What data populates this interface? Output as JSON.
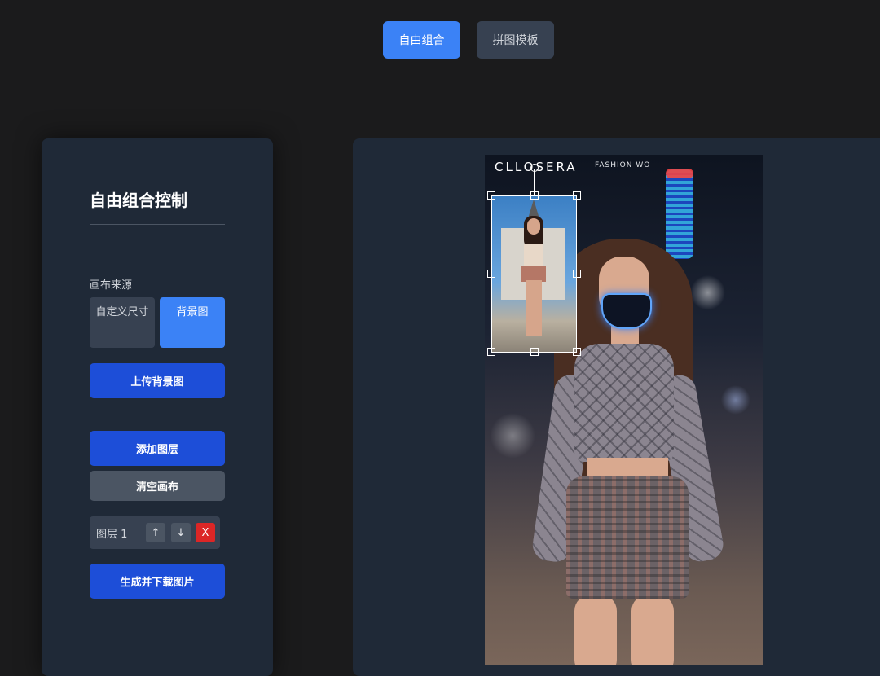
{
  "mode_tabs": {
    "free": "自由组合",
    "puzzle": "拼图模板"
  },
  "control_panel": {
    "title": "自由组合控制",
    "canvas_source_label": "画布来源",
    "source_custom": "自定义尺寸",
    "source_background": "背景图",
    "upload_background": "上传背景图",
    "add_layer": "添加图层",
    "clear_canvas": "清空画布",
    "layers": [
      {
        "name": "图层 1",
        "up": "↑",
        "down": "↓",
        "delete": "X"
      }
    ],
    "generate_download": "生成并下载图片"
  },
  "canvas": {
    "brand": "CLLOSERA",
    "brand_sub": "FASHION WO"
  },
  "colors": {
    "active_tab": "#3b82f6",
    "primary_button": "#1d4ed8",
    "delete_button": "#dc2626",
    "panel_bg": "#1f2937"
  }
}
